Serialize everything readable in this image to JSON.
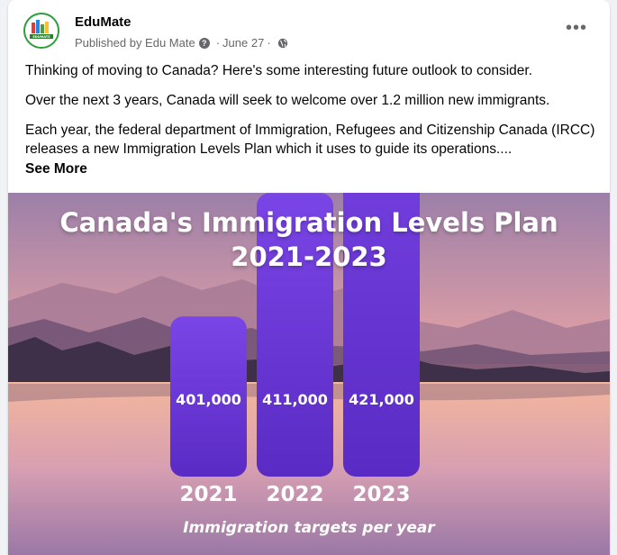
{
  "post": {
    "page_name": "EduMate",
    "published_by": "Published by Edu Mate",
    "date": "June 27",
    "separator": "·",
    "help_glyph": "?",
    "more_glyph": "•••",
    "paragraphs": [
      "Thinking of moving to Canada? Here's some interesting future outlook to consider.",
      "Over the next 3 years, Canada will seek to welcome over 1.2 million new immigrants.",
      "Each year, the federal department of Immigration, Refugees and Citizenship Canada (IRCC) releases a new Immigration Levels Plan which it uses to guide its operations...."
    ],
    "see_more": "See More",
    "avatar_text": "EDUMATE"
  },
  "image": {
    "title_line1": "Canada's Immigration Levels Plan",
    "title_line2": "2021-2023",
    "caption": "Immigration targets per year"
  },
  "chart_data": {
    "type": "bar",
    "categories": [
      "2021",
      "2022",
      "2023"
    ],
    "values": [
      401000,
      411000,
      421000
    ],
    "value_labels": [
      "401,000",
      "411,000",
      "421,000"
    ],
    "title": "Canada's Immigration Levels Plan 2021-2023",
    "xlabel": "Immigration targets per year",
    "ylabel": "",
    "bar_color": "#6a35d6"
  },
  "colors": {
    "accent_green": "#2e9e3b",
    "text_primary": "#050505",
    "text_secondary": "#65676b"
  }
}
